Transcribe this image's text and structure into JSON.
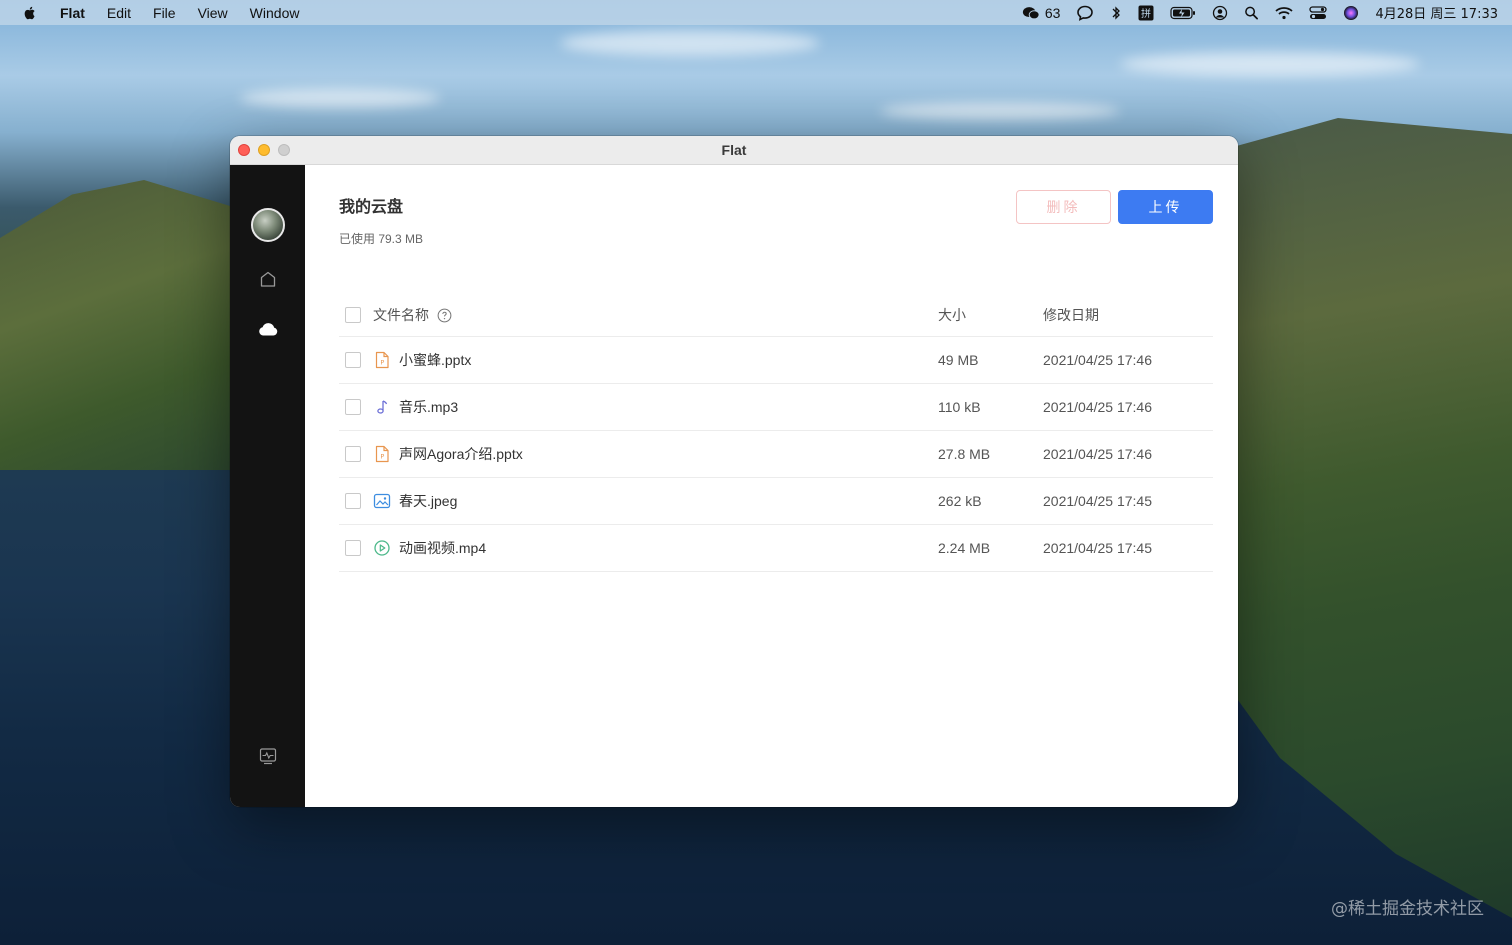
{
  "menubar": {
    "app_name": "Flat",
    "menus": [
      "Edit",
      "File",
      "View",
      "Window"
    ],
    "wechat_count": "63",
    "datetime": "4月28日 周三  17:33",
    "icons": [
      "apple-icon",
      "wechat-icon",
      "chat-icon",
      "bluetooth-icon",
      "input-method-icon",
      "battery-icon",
      "user-icon",
      "search-icon",
      "wifi-icon",
      "control-center-icon",
      "siri-icon"
    ]
  },
  "window": {
    "title": "Flat"
  },
  "sidebar": {
    "items": [
      "avatar",
      "home-icon",
      "cloud-icon",
      "diagnostic-icon"
    ]
  },
  "main": {
    "title": "我的云盘",
    "usage": "已使用 79.3 MB",
    "delete_label": "删除",
    "upload_label": "上传",
    "columns": {
      "name": "文件名称",
      "size": "大小",
      "date": "修改日期"
    },
    "files": [
      {
        "name": "小蜜蜂.pptx",
        "size": "49 MB",
        "date": "2021/04/25 17:46",
        "icon": "pptx-file-icon"
      },
      {
        "name": "音乐.mp3",
        "size": "110 kB",
        "date": "2021/04/25 17:46",
        "icon": "music-file-icon"
      },
      {
        "name": "声网Agora介绍.pptx",
        "size": "27.8 MB",
        "date": "2021/04/25 17:46",
        "icon": "pptx-file-icon"
      },
      {
        "name": "春天.jpeg",
        "size": "262 kB",
        "date": "2021/04/25 17:45",
        "icon": "image-file-icon"
      },
      {
        "name": "动画视频.mp4",
        "size": "2.24 MB",
        "date": "2021/04/25 17:45",
        "icon": "video-file-icon"
      }
    ]
  },
  "watermark": "@稀土掘金技术社区",
  "colors": {
    "accent": "#3d7bf2",
    "delete_border": "#f4c4c4",
    "sidebar_bg": "#131313"
  }
}
